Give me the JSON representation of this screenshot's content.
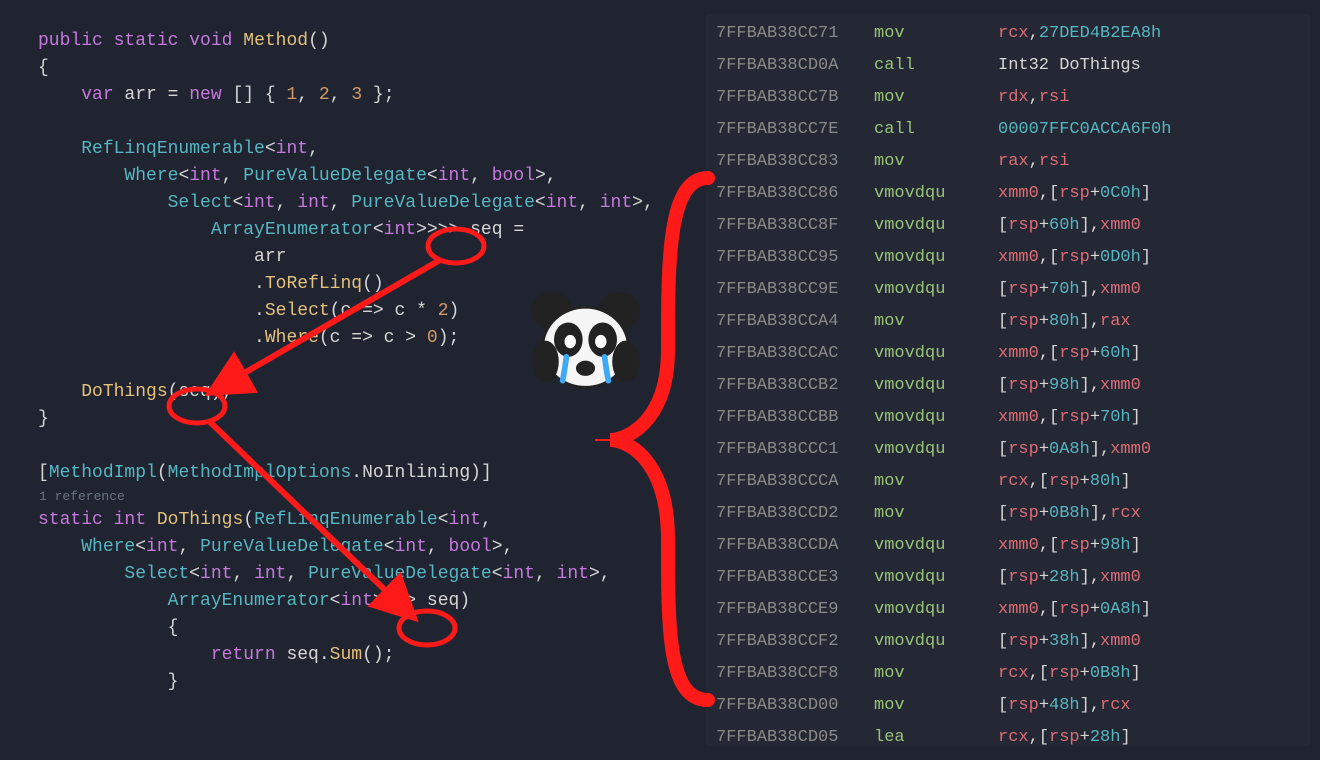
{
  "code": {
    "line1_public": "public",
    "line1_static": "static",
    "line1_void": "void",
    "line1_method": "Method",
    "line1_paren": "()",
    "line2": "{",
    "line3_var": "var",
    "line3_arr": " arr = ",
    "line3_new": "new",
    "line3_mid": " [] { ",
    "line3_1": "1",
    "line3_c1": ", ",
    "line3_2": "2",
    "line3_c2": ", ",
    "line3_3": "3",
    "line3_end": " };",
    "line5_type": "RefLinqEnumerable",
    "line5_lt": "<",
    "line5_int": "int",
    "line5_comma": ",",
    "line6_where": "Where",
    "line6_lt": "<",
    "line6_int1": "int",
    "line6_c1": ", ",
    "line6_pvd": "PureValueDelegate",
    "line6_lt2": "<",
    "line6_int2": "int",
    "line6_c2": ", ",
    "line6_bool": "bool",
    "line6_gt": ">,",
    "line6_close": ">,",
    "line7_select": "Select",
    "line7_lt": "<",
    "line7_int1": "int",
    "line7_c1": ", ",
    "line7_int2": "int",
    "line7_c2": ", ",
    "line7_pvd": "PureValueDelegate",
    "line7_lt2": "<",
    "line7_int3": "int",
    "line7_c3": ", ",
    "line7_int4": "int",
    "line7_gt": ">,",
    "line7_close": ">,",
    "line8_ae": "ArrayEnumerator",
    "line8_lt": "<",
    "line8_int": "int",
    "line8_gt": ">>>>",
    "line8_seq": " seq ",
    "line8_eq": "=",
    "line9_arr": "arr",
    "line10_trl": ".ToRefLinq()",
    "line11_sel": ".Select(c => c * ",
    "line11_2": "2",
    "line11_end": ")",
    "line12_whr": ".Where(c => c > ",
    "line12_0": "0",
    "line12_end": ");",
    "line14_do": "DoThings",
    "line14_open": "(",
    "line14_seq": "seq",
    "line14_close": ");",
    "line15": "}",
    "line17_open": "[",
    "line17_mi": "MethodImpl",
    "line17_p": "(",
    "line17_mio": "MethodImplOptions",
    "line17_dot": ".",
    "line17_ni": "NoInlining",
    "line17_close": ")]",
    "line18_ref": "1 reference",
    "line19_static": "static",
    "line19_int": "int",
    "line19_do": "DoThings",
    "line19_p": "(",
    "line19_rle": "RefLinqEnumerable",
    "line19_lt": "<",
    "line19_int2": "int",
    "line19_c": ",",
    "line20_where": "Where",
    "line20_lt": "<",
    "line20_int1": "int",
    "line20_c1": ", ",
    "line20_pvd": "PureValueDelegate",
    "line20_lt2": "<",
    "line20_int2": "int",
    "line20_c2": ", ",
    "line20_bool": "bool",
    "line20_gt": ">,",
    "line20_close": ">,",
    "line21_select": "Select",
    "line21_lt": "<",
    "line21_int1": "int",
    "line21_c1": ", ",
    "line21_int2": "int",
    "line21_c2": ", ",
    "line21_pvd": "PureValueDelegate",
    "line21_lt2": "<",
    "line21_int3": "int",
    "line21_c3": ", ",
    "line21_int4": "int",
    "line21_gt": ">,",
    "line21_close": ">,",
    "line22_ae": "ArrayEnumerator",
    "line22_lt": "<",
    "line22_int": "int",
    "line22_gt": ">>>>",
    "line22_seq": " seq",
    "line22_close": ")",
    "line23": "{",
    "line24_ret": "return",
    "line24_seq": " seq.",
    "line24_sum": "Sum",
    "line24_end": "();",
    "line25": "}"
  },
  "asm": [
    {
      "addr": "7FFBAB38CC71",
      "mnem": "mov",
      "ops": [
        [
          "reg",
          "rcx"
        ],
        [
          "pl",
          ","
        ],
        [
          "hex",
          "27DED4B2EA8h"
        ]
      ]
    },
    {
      "addr": "7FFBAB38CD0A",
      "mnem": "call",
      "ops": [
        [
          "pl",
          "Int32 DoThings"
        ]
      ]
    },
    {
      "addr": "7FFBAB38CC7B",
      "mnem": "mov",
      "ops": [
        [
          "reg",
          "rdx"
        ],
        [
          "pl",
          ","
        ],
        [
          "reg",
          "rsi"
        ]
      ]
    },
    {
      "addr": "7FFBAB38CC7E",
      "mnem": "call",
      "ops": [
        [
          "hex",
          "00007FFC0ACCA6F0h"
        ]
      ]
    },
    {
      "addr": "7FFBAB38CC83",
      "mnem": "mov",
      "ops": [
        [
          "reg",
          "rax"
        ],
        [
          "pl",
          ","
        ],
        [
          "reg",
          "rsi"
        ]
      ]
    },
    {
      "addr": "7FFBAB38CC86",
      "mnem": "vmovdqu",
      "ops": [
        [
          "reg",
          "xmm0"
        ],
        [
          "pl",
          ",["
        ],
        [
          "reg",
          "rsp"
        ],
        [
          "pl",
          "+"
        ],
        [
          "hex",
          "0C0h"
        ],
        [
          "pl",
          "]"
        ]
      ]
    },
    {
      "addr": "7FFBAB38CC8F",
      "mnem": "vmovdqu",
      "ops": [
        [
          "pl",
          "["
        ],
        [
          "reg",
          "rsp"
        ],
        [
          "pl",
          "+"
        ],
        [
          "hex",
          "60h"
        ],
        [
          "pl",
          "],"
        ],
        [
          "reg",
          "xmm0"
        ]
      ]
    },
    {
      "addr": "7FFBAB38CC95",
      "mnem": "vmovdqu",
      "ops": [
        [
          "reg",
          "xmm0"
        ],
        [
          "pl",
          ",["
        ],
        [
          "reg",
          "rsp"
        ],
        [
          "pl",
          "+"
        ],
        [
          "hex",
          "0D0h"
        ],
        [
          "pl",
          "]"
        ]
      ]
    },
    {
      "addr": "7FFBAB38CC9E",
      "mnem": "vmovdqu",
      "ops": [
        [
          "pl",
          "["
        ],
        [
          "reg",
          "rsp"
        ],
        [
          "pl",
          "+"
        ],
        [
          "hex",
          "70h"
        ],
        [
          "pl",
          "],"
        ],
        [
          "reg",
          "xmm0"
        ]
      ]
    },
    {
      "addr": "7FFBAB38CCA4",
      "mnem": "mov",
      "ops": [
        [
          "pl",
          "["
        ],
        [
          "reg",
          "rsp"
        ],
        [
          "pl",
          "+"
        ],
        [
          "hex",
          "80h"
        ],
        [
          "pl",
          "],"
        ],
        [
          "reg",
          "rax"
        ]
      ]
    },
    {
      "addr": "7FFBAB38CCAC",
      "mnem": "vmovdqu",
      "ops": [
        [
          "reg",
          "xmm0"
        ],
        [
          "pl",
          ",["
        ],
        [
          "reg",
          "rsp"
        ],
        [
          "pl",
          "+"
        ],
        [
          "hex",
          "60h"
        ],
        [
          "pl",
          "]"
        ]
      ]
    },
    {
      "addr": "7FFBAB38CCB2",
      "mnem": "vmovdqu",
      "ops": [
        [
          "pl",
          "["
        ],
        [
          "reg",
          "rsp"
        ],
        [
          "pl",
          "+"
        ],
        [
          "hex",
          "98h"
        ],
        [
          "pl",
          "],"
        ],
        [
          "reg",
          "xmm0"
        ]
      ]
    },
    {
      "addr": "7FFBAB38CCBB",
      "mnem": "vmovdqu",
      "ops": [
        [
          "reg",
          "xmm0"
        ],
        [
          "pl",
          ",["
        ],
        [
          "reg",
          "rsp"
        ],
        [
          "pl",
          "+"
        ],
        [
          "hex",
          "70h"
        ],
        [
          "pl",
          "]"
        ]
      ]
    },
    {
      "addr": "7FFBAB38CCC1",
      "mnem": "vmovdqu",
      "ops": [
        [
          "pl",
          "["
        ],
        [
          "reg",
          "rsp"
        ],
        [
          "pl",
          "+"
        ],
        [
          "hex",
          "0A8h"
        ],
        [
          "pl",
          "],"
        ],
        [
          "reg",
          "xmm0"
        ]
      ]
    },
    {
      "addr": "7FFBAB38CCCA",
      "mnem": "mov",
      "ops": [
        [
          "reg",
          "rcx"
        ],
        [
          "pl",
          ",["
        ],
        [
          "reg",
          "rsp"
        ],
        [
          "pl",
          "+"
        ],
        [
          "hex",
          "80h"
        ],
        [
          "pl",
          "]"
        ]
      ]
    },
    {
      "addr": "7FFBAB38CCD2",
      "mnem": "mov",
      "ops": [
        [
          "pl",
          "["
        ],
        [
          "reg",
          "rsp"
        ],
        [
          "pl",
          "+"
        ],
        [
          "hex",
          "0B8h"
        ],
        [
          "pl",
          "],"
        ],
        [
          "reg",
          "rcx"
        ]
      ]
    },
    {
      "addr": "7FFBAB38CCDA",
      "mnem": "vmovdqu",
      "ops": [
        [
          "reg",
          "xmm0"
        ],
        [
          "pl",
          ",["
        ],
        [
          "reg",
          "rsp"
        ],
        [
          "pl",
          "+"
        ],
        [
          "hex",
          "98h"
        ],
        [
          "pl",
          "]"
        ]
      ]
    },
    {
      "addr": "7FFBAB38CCE3",
      "mnem": "vmovdqu",
      "ops": [
        [
          "pl",
          "["
        ],
        [
          "reg",
          "rsp"
        ],
        [
          "pl",
          "+"
        ],
        [
          "hex",
          "28h"
        ],
        [
          "pl",
          "],"
        ],
        [
          "reg",
          "xmm0"
        ]
      ]
    },
    {
      "addr": "7FFBAB38CCE9",
      "mnem": "vmovdqu",
      "ops": [
        [
          "reg",
          "xmm0"
        ],
        [
          "pl",
          ",["
        ],
        [
          "reg",
          "rsp"
        ],
        [
          "pl",
          "+"
        ],
        [
          "hex",
          "0A8h"
        ],
        [
          "pl",
          "]"
        ]
      ]
    },
    {
      "addr": "7FFBAB38CCF2",
      "mnem": "vmovdqu",
      "ops": [
        [
          "pl",
          "["
        ],
        [
          "reg",
          "rsp"
        ],
        [
          "pl",
          "+"
        ],
        [
          "hex",
          "38h"
        ],
        [
          "pl",
          "],"
        ],
        [
          "reg",
          "xmm0"
        ]
      ]
    },
    {
      "addr": "7FFBAB38CCF8",
      "mnem": "mov",
      "ops": [
        [
          "reg",
          "rcx"
        ],
        [
          "pl",
          ",["
        ],
        [
          "reg",
          "rsp"
        ],
        [
          "pl",
          "+"
        ],
        [
          "hex",
          "0B8h"
        ],
        [
          "pl",
          "]"
        ]
      ]
    },
    {
      "addr": "7FFBAB38CD00",
      "mnem": "mov",
      "ops": [
        [
          "pl",
          "["
        ],
        [
          "reg",
          "rsp"
        ],
        [
          "pl",
          "+"
        ],
        [
          "hex",
          "48h"
        ],
        [
          "pl",
          "],"
        ],
        [
          "reg",
          "rcx"
        ]
      ]
    },
    {
      "addr": "7FFBAB38CD05",
      "mnem": "lea",
      "ops": [
        [
          "reg",
          "rcx"
        ],
        [
          "pl",
          ",["
        ],
        [
          "reg",
          "rsp"
        ],
        [
          "pl",
          "+"
        ],
        [
          "hex",
          "28h"
        ],
        [
          "pl",
          "]"
        ]
      ]
    }
  ]
}
